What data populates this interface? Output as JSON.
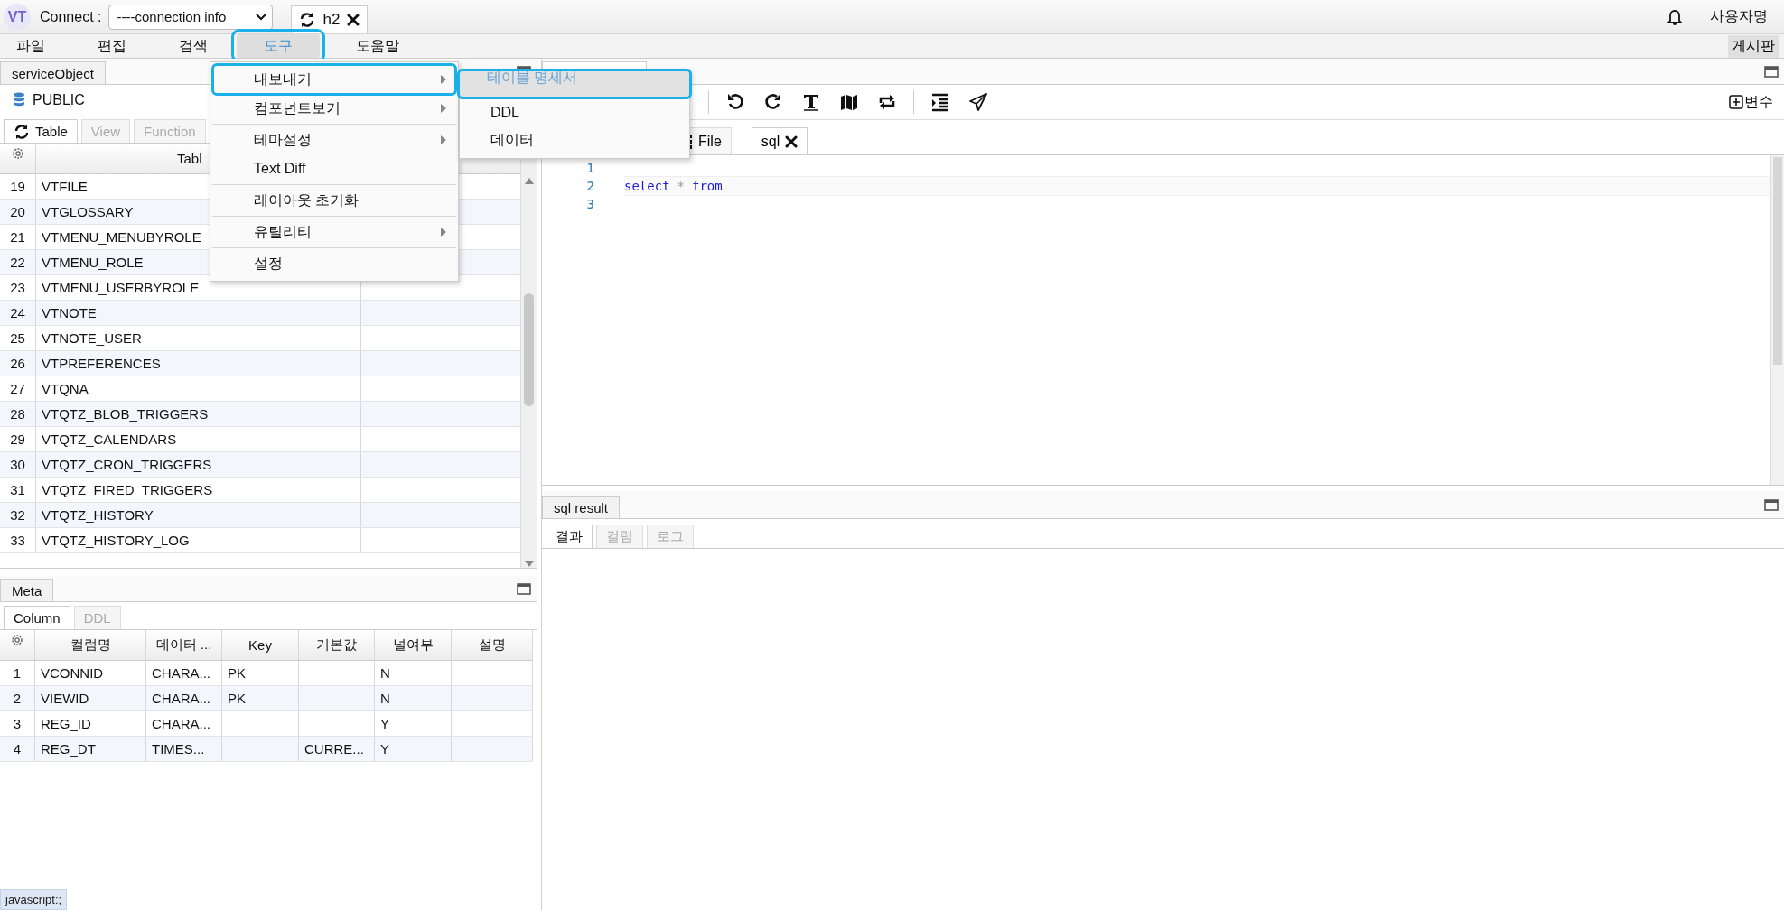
{
  "app": {
    "logo": "VT",
    "connect_label": "Connect :",
    "connection_select": "----connection info",
    "session_tabs": [
      {
        "label": "h2",
        "selected": true
      }
    ],
    "user_name": "사용자명"
  },
  "menu_bar": {
    "items": [
      {
        "label": "파일",
        "selected": false
      },
      {
        "label": "편집",
        "selected": false
      },
      {
        "label": "검색",
        "selected": false
      },
      {
        "label": "도구",
        "selected": true
      },
      {
        "label": "도움말",
        "selected": false
      }
    ],
    "board_button": "게시판"
  },
  "tools_menu": {
    "items": [
      {
        "kind": "item",
        "label": "내보내기",
        "submenu": true,
        "selected": true
      },
      {
        "kind": "item",
        "label": "컴포넌트보기",
        "submenu": true,
        "selected": false
      },
      {
        "kind": "separator"
      },
      {
        "kind": "item",
        "label": "테마설정",
        "submenu": true,
        "selected": false
      },
      {
        "kind": "item",
        "label": "Text Diff",
        "submenu": false,
        "selected": false
      },
      {
        "kind": "separator"
      },
      {
        "kind": "item",
        "label": "레이아웃 초기화",
        "submenu": false,
        "selected": false
      },
      {
        "kind": "separator"
      },
      {
        "kind": "item",
        "label": "유틸리티",
        "submenu": true,
        "selected": false
      },
      {
        "kind": "separator"
      },
      {
        "kind": "item",
        "label": "설정",
        "submenu": false,
        "selected": false
      }
    ]
  },
  "export_submenu": {
    "items": [
      {
        "label": "테이블 명세서",
        "selected": true
      },
      {
        "label": "DDL",
        "selected": false
      },
      {
        "label": "데이터",
        "selected": false
      }
    ]
  },
  "object_panel": {
    "tab": "serviceObject",
    "schema": "PUBLIC",
    "object_tabs": [
      {
        "label": "Table",
        "selected": true
      },
      {
        "label": "View",
        "selected": false
      },
      {
        "label": "Function",
        "selected": false
      }
    ],
    "table_header": "Tabl",
    "rows": [
      {
        "no": "19",
        "name": "VTFILE"
      },
      {
        "no": "20",
        "name": "VTGLOSSARY"
      },
      {
        "no": "21",
        "name": "VTMENU_MENUBYROLE"
      },
      {
        "no": "22",
        "name": "VTMENU_ROLE"
      },
      {
        "no": "23",
        "name": "VTMENU_USERBYROLE"
      },
      {
        "no": "24",
        "name": "VTNOTE"
      },
      {
        "no": "25",
        "name": "VTNOTE_USER"
      },
      {
        "no": "26",
        "name": "VTPREFERENCES"
      },
      {
        "no": "27",
        "name": "VTQNA"
      },
      {
        "no": "28",
        "name": "VTQTZ_BLOB_TRIGGERS"
      },
      {
        "no": "29",
        "name": "VTQTZ_CALENDARS"
      },
      {
        "no": "30",
        "name": "VTQTZ_CRON_TRIGGERS"
      },
      {
        "no": "31",
        "name": "VTQTZ_FIRED_TRIGGERS"
      },
      {
        "no": "32",
        "name": "VTQTZ_HISTORY"
      },
      {
        "no": "33",
        "name": "VTQTZ_HISTORY_LOG"
      }
    ]
  },
  "meta_panel": {
    "tab": "Meta",
    "sub_tabs": [
      {
        "label": "Column",
        "selected": true
      },
      {
        "label": "DDL",
        "selected": false
      }
    ],
    "columns": [
      "컬럼명",
      "데이터 ...",
      "Key",
      "기본값",
      "널여부",
      "설명"
    ],
    "rows": [
      {
        "no": "1",
        "cells": [
          "VCONNID",
          "CHARA...",
          "PK",
          "",
          "N",
          ""
        ]
      },
      {
        "no": "2",
        "cells": [
          "VIEWID",
          "CHARA...",
          "PK",
          "",
          "N",
          ""
        ]
      },
      {
        "no": "3",
        "cells": [
          "REG_ID",
          "CHARA...",
          "",
          "",
          "Y",
          ""
        ]
      },
      {
        "no": "4",
        "cells": [
          "REG_DT",
          "TIMES...",
          "",
          "CURRE...",
          "Y",
          ""
        ]
      }
    ]
  },
  "editor": {
    "variables_button": "변수",
    "tabs": [
      {
        "label": "File",
        "selected": false,
        "closable": false
      },
      {
        "label": "sql",
        "selected": true,
        "closable": true
      }
    ],
    "lines": [
      {
        "no": "1",
        "current": false
      },
      {
        "no": "2",
        "current": true,
        "tokens": [
          {
            "kind": "keyword",
            "text": "select"
          },
          {
            "kind": "operator",
            "text": "*"
          },
          {
            "kind": "keyword",
            "text": "from"
          }
        ]
      },
      {
        "no": "3",
        "current": false
      }
    ]
  },
  "result_panel": {
    "tab": "sql result",
    "sub_tabs": [
      {
        "label": "결과",
        "selected": true
      },
      {
        "label": "컬럼",
        "selected": false
      },
      {
        "label": "로그",
        "selected": false
      }
    ]
  },
  "status_link": "javascript:;"
}
